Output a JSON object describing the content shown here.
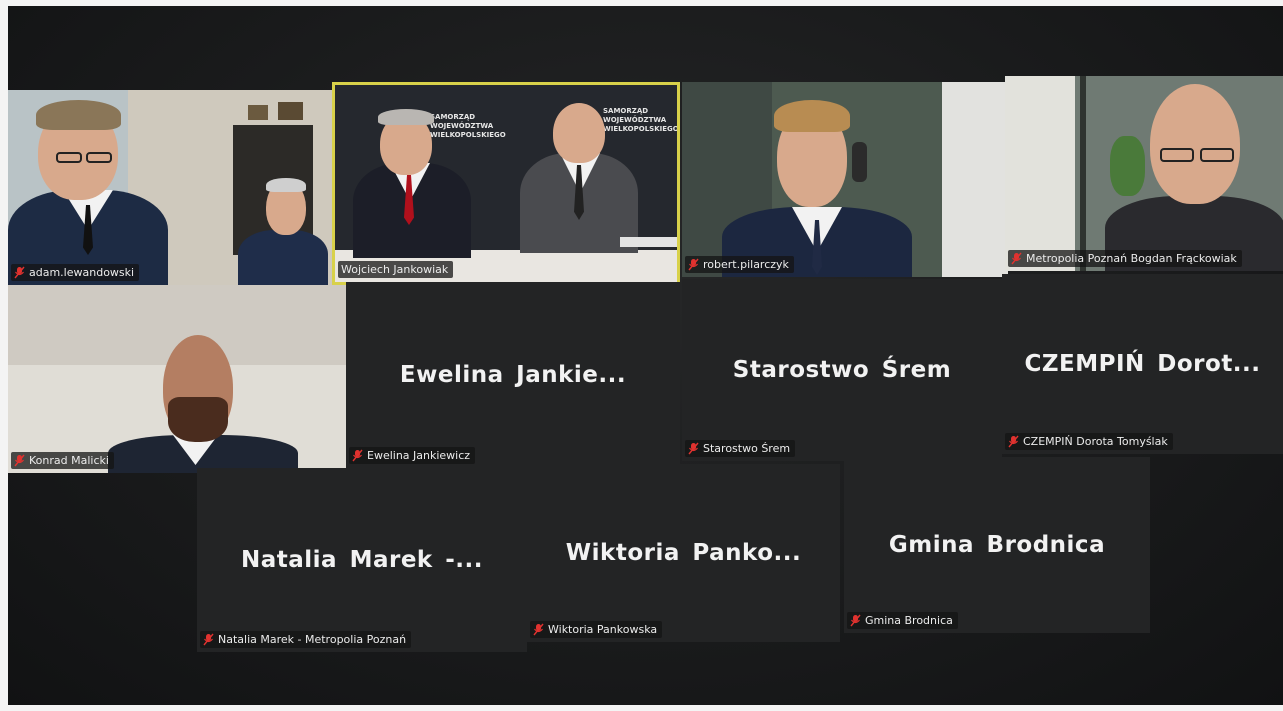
{
  "participants": [
    {
      "id": "p1",
      "label": "adam.lewandowski",
      "muted": true,
      "video": true
    },
    {
      "id": "p2",
      "label": "Wojciech Jankowiak",
      "muted": false,
      "video": true,
      "active_speaker": true,
      "backdrop_text": "SAMORZĄD WOJEWÓDZTWA WIELKOPOLSKIEGO"
    },
    {
      "id": "p3",
      "label": "robert.pilarczyk",
      "muted": true,
      "video": true
    },
    {
      "id": "p4",
      "label": "Metropolia Poznań Bogdan Frąckowiak",
      "muted": true,
      "video": true
    },
    {
      "id": "p5",
      "label": "Konrad Malicki",
      "muted": true,
      "video": true
    },
    {
      "id": "p6",
      "label": "Ewelina Jankiewicz",
      "display": "Ewelina  Jankie...",
      "muted": true,
      "video": false
    },
    {
      "id": "p7",
      "label": "Starostwo Śrem",
      "display": "Starostwo  Śrem",
      "muted": true,
      "video": false
    },
    {
      "id": "p8",
      "label": "CZEMPIŃ Dorota Tomyślak",
      "display": "CZEMPIŃ  Dorot...",
      "muted": true,
      "video": false
    },
    {
      "id": "p9",
      "label": "Natalia Marek - Metropolia Poznań",
      "display": "Natalia  Marek  -...",
      "muted": true,
      "video": false
    },
    {
      "id": "p10",
      "label": "Wiktoria Pankowska",
      "display": "Wiktoria  Panko...",
      "muted": true,
      "video": false
    },
    {
      "id": "p11",
      "label": "Gmina Brodnica",
      "display": "Gmina  Brodnica",
      "muted": true,
      "video": false
    }
  ],
  "icons": {
    "muted": "microphone-muted-icon"
  },
  "colors": {
    "active_border": "#d8d14a",
    "muted_icon": "#e0322f",
    "tile_bg": "#232425"
  }
}
